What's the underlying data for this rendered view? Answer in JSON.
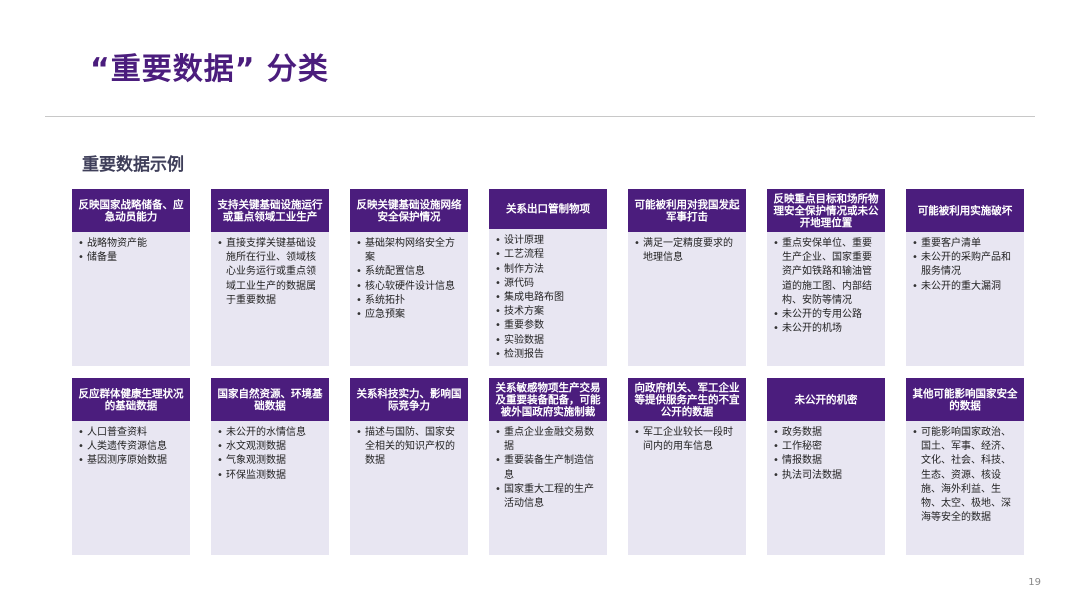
{
  "title": "“重要数据” 分类",
  "subtitle": "重要数据示例",
  "page_number": "19",
  "colors": {
    "header_bg": "#4b1d7d",
    "body_bg": "#e8e6f2",
    "title": "#4b1d7d"
  },
  "cards": [
    {
      "title": "反映国家战略储备、应急动员能力",
      "items": [
        "战略物资产能",
        "储备量"
      ]
    },
    {
      "title": "支持关键基础设施运行或重点领域工业生产",
      "items": [
        "直接支撑关键基础设施所在行业、领域核心业务运行或重点领域工业生产的数据属于重要数据"
      ]
    },
    {
      "title": "反映关键基础设施网络安全保护情况",
      "items": [
        "基础架构网络安全方案",
        "系统配置信息",
        "核心软硬件设计信息",
        "系统拓扑",
        "应急预案"
      ]
    },
    {
      "title": "关系出口管制物项",
      "items": [
        "设计原理",
        "工艺流程",
        "制作方法",
        "源代码",
        "集成电路布图",
        "技术方案",
        "重要参数",
        "实验数据",
        "检测报告"
      ]
    },
    {
      "title": "可能被利用对我国发起军事打击",
      "items": [
        "满足一定精度要求的地理信息"
      ]
    },
    {
      "title": "反映重点目标和场所物理安全保护情况或未公开地理位置",
      "items": [
        "重点安保单位、重要生产企业、国家重要资产如铁路和输油管道的施工图、内部结构、安防等情况",
        "未公开的专用公路",
        "未公开的机场"
      ]
    },
    {
      "title": "可能被利用实施破坏",
      "items": [
        "重要客户清单",
        "未公开的采购产品和服务情况",
        "未公开的重大漏洞"
      ]
    },
    {
      "title": "反应群体健康生理状况的基础数据",
      "items": [
        "人口普查资料",
        "人类遗传资源信息",
        "基因测序原始数据"
      ]
    },
    {
      "title": "国家自然资源、环境基础数据",
      "items": [
        "未公开的水情信息",
        "水文观测数据",
        "气象观测数据",
        "环保监测数据"
      ]
    },
    {
      "title": "关系科技实力、影响国际竞争力",
      "items": [
        "描述与国防、国家安全相关的知识产权的数据"
      ]
    },
    {
      "title": "关系敏感物项生产交易及重要装备配备，可能被外国政府实施制裁",
      "items": [
        "重点企业金融交易数据",
        "重要装备生产制造信息",
        "国家重大工程的生产活动信息"
      ]
    },
    {
      "title": "向政府机关、军工企业等提供服务产生的不宜公开的数据",
      "items": [
        "军工企业较长一段时间内的用车信息"
      ]
    },
    {
      "title": "未公开的机密",
      "items": [
        "政务数据",
        "工作秘密",
        "情报数据",
        "执法司法数据"
      ]
    },
    {
      "title": "其他可能影响国家安全的数据",
      "items": [
        "可能影响国家政治、国土、军事、经济、文化、社会、科技、生态、资源、核设施、海外利益、生物、太空、极地、深海等安全的数据"
      ]
    }
  ]
}
